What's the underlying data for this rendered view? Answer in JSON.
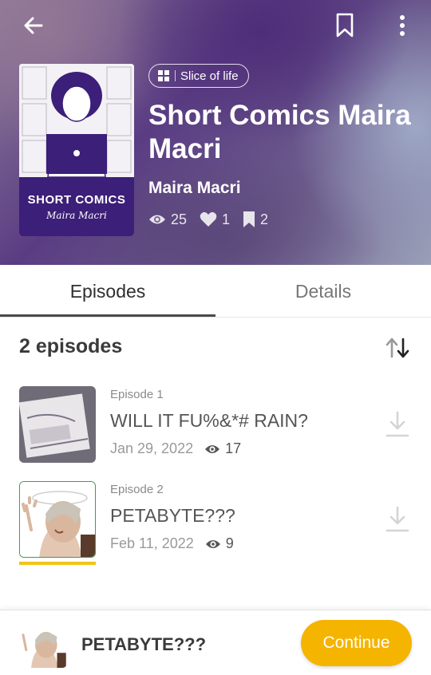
{
  "header": {
    "genre": "Slice of life",
    "title": "Short Comics Maira Macri",
    "author": "Maira Macri",
    "stats": {
      "views": "25",
      "likes": "1",
      "bookmarks": "2"
    },
    "cover": {
      "title": "SHORT COMICS",
      "subtitle": "Maira Macri"
    }
  },
  "tabs": [
    {
      "label": "Episodes",
      "active": true
    },
    {
      "label": "Details",
      "active": false
    }
  ],
  "episodes": {
    "heading": "2 episodes",
    "items": [
      {
        "number": "Episode 1",
        "title": "WILL IT FU%&*# RAIN?",
        "date": "Jan 29, 2022",
        "views": "17",
        "progress": 0
      },
      {
        "number": "Episode 2",
        "title": "PETABYTE???",
        "date": "Feb 11, 2022",
        "views": "9",
        "progress": 1.0
      }
    ]
  },
  "bottom_bar": {
    "title": "PETABYTE???",
    "continue_label": "Continue"
  },
  "colors": {
    "accent": "#f5b400",
    "cover_band": "#3c1f78",
    "progress": "#f0c419"
  }
}
